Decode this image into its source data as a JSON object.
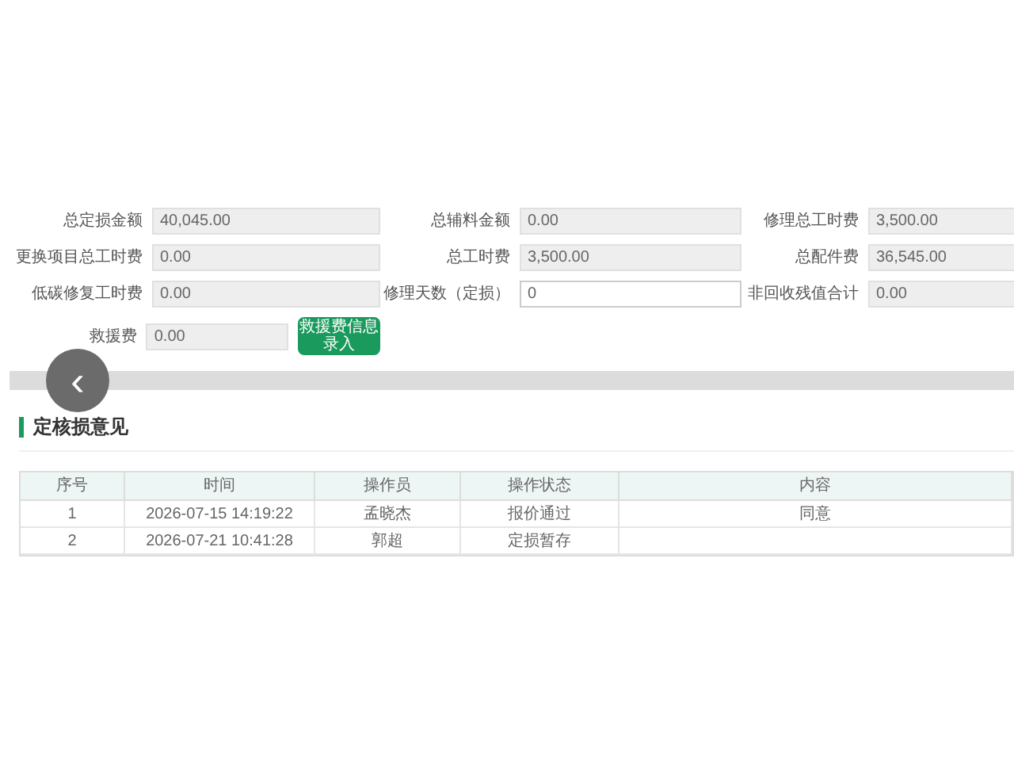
{
  "fields": [
    {
      "label": "总定损金额",
      "value": "40,045.00",
      "disabled": true
    },
    {
      "label": "总辅料金额",
      "value": "0.00",
      "disabled": true
    },
    {
      "label": "修理总工时费",
      "value": "3,500.00",
      "disabled": true
    },
    {
      "label": "更换项目总工时费",
      "value": "0.00",
      "disabled": true
    },
    {
      "label": "总工时费",
      "value": "3,500.00",
      "disabled": true
    },
    {
      "label": "总配件费",
      "value": "36,545.00",
      "disabled": true
    },
    {
      "label": "低碳修复工时费",
      "value": "0.00",
      "disabled": true
    },
    {
      "label": "修理天数（定损）",
      "value": "0",
      "disabled": false
    },
    {
      "label": "非回收残值合计",
      "value": "0.00",
      "disabled": true
    }
  ],
  "rescue": {
    "label": "救援费",
    "value": "0.00",
    "disabled": true,
    "button": "救援费信息录入"
  },
  "back_button": "‹",
  "section_title": "定核损意见",
  "table": {
    "columns": [
      "序号",
      "时间",
      "操作员",
      "操作状态",
      "内容"
    ],
    "rows": [
      [
        "1",
        "2026-07-15 14:19:22",
        "孟晓杰",
        "报价通过",
        "同意"
      ],
      [
        "2",
        "2026-07-21 10:41:28",
        "郭超",
        "定损暂存",
        ""
      ]
    ]
  }
}
